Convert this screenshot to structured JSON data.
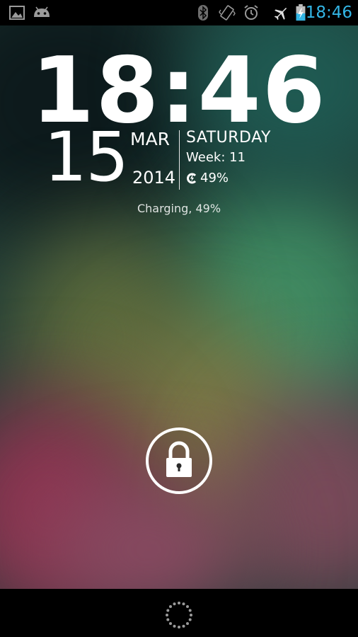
{
  "status_bar": {
    "left_icons": [
      "image-icon",
      "android-icon"
    ],
    "right_icons": [
      "bluetooth-icon",
      "vibrate-icon",
      "alarm-icon",
      "airplane-mode-icon",
      "battery-charging-icon"
    ],
    "time": "18:46",
    "time_color": "#33b5e5"
  },
  "lockscreen": {
    "clock_time": "18:46",
    "day": "15",
    "month": "MAR",
    "year": "2014",
    "weekday": "SATURDAY",
    "week": "Week: 11",
    "battery_percent": "49%",
    "charging_text": "Charging, 49%"
  },
  "controls": {
    "unlock_icon": "lock-icon",
    "bottom_icon": "loading-dots-icon"
  }
}
